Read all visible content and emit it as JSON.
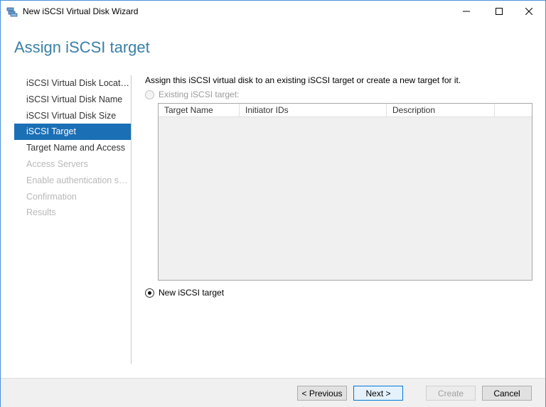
{
  "window": {
    "title": "New iSCSI Virtual Disk Wizard"
  },
  "page": {
    "title": "Assign iSCSI target"
  },
  "nav": {
    "items": [
      {
        "label": "iSCSI Virtual Disk Location",
        "state": "normal"
      },
      {
        "label": "iSCSI Virtual Disk Name",
        "state": "normal"
      },
      {
        "label": "iSCSI Virtual Disk Size",
        "state": "normal"
      },
      {
        "label": "iSCSI Target",
        "state": "active"
      },
      {
        "label": "Target Name and Access",
        "state": "normal"
      },
      {
        "label": "Access Servers",
        "state": "disabled"
      },
      {
        "label": "Enable authentication ser...",
        "state": "disabled"
      },
      {
        "label": "Confirmation",
        "state": "disabled"
      },
      {
        "label": "Results",
        "state": "disabled"
      }
    ]
  },
  "content": {
    "instruction": "Assign this iSCSI virtual disk to an existing iSCSI target or create a new target for it.",
    "existing_target_label": "Existing iSCSI target:",
    "new_target_label": "New iSCSI target",
    "grid": {
      "columns": [
        "Target Name",
        "Initiator IDs",
        "Description",
        ""
      ]
    }
  },
  "buttons": {
    "previous": "< Previous",
    "next": "Next >",
    "create": "Create",
    "cancel": "Cancel"
  },
  "colors": {
    "accent": "#1b6fb5",
    "title": "#3a7fa8"
  }
}
